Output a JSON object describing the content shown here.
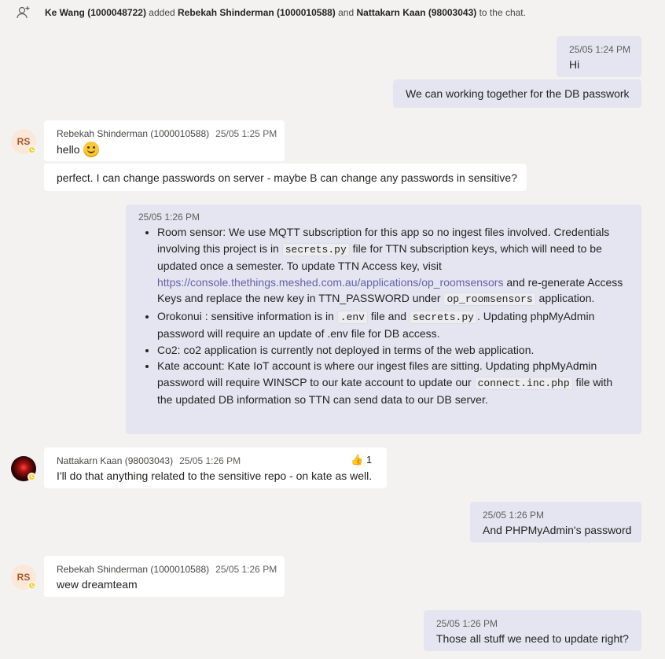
{
  "system_message": {
    "icon": "add-person-icon",
    "actor": "Ke Wang (1000048722)",
    "added_verb": "added",
    "user1": "Rebekah Shinderman (1000010588)",
    "and_word": "and",
    "user2": "Nattakarn Kaan (98003043)",
    "suffix": "to the chat."
  },
  "messages": {
    "m1": {
      "time": "25/05 1:24 PM",
      "text": "Hi"
    },
    "m2": {
      "text": "We can working together for the DB passwork"
    },
    "m3": {
      "initials": "RS",
      "sender": "Rebekah Shinderman (1000010588)",
      "time": "25/05 1:25 PM",
      "text": "hello",
      "emoji": "slightly-smiling-face-emoji"
    },
    "m4": {
      "text": "perfect. I can change passwords on server -  maybe B can change  any  passwords in sensitive?"
    },
    "m5": {
      "time": "25/05 1:26 PM",
      "b1_t1": "Room sensor: We use MQTT subscription for this app so no ingest files involved. Credentials involving this project is in ",
      "b1_code1": "secrets.py",
      "b1_t2": " file for TTN subscription keys, which will need to be updated once a semester. To update TTN Access key, visit ",
      "b1_link": "https://console.thethings.meshed.com.au/applications/op_roomsensors",
      "b1_t3": " and re-generate Access Keys and replace the new key in TTN_PASSWORD under ",
      "b1_code2": "op_roomsensors",
      "b1_t4": " application.",
      "b2_t1": "Orokonui : sensitive information is in ",
      "b2_code1": ".env",
      "b2_t2": " file and ",
      "b2_code2": "secrets.py",
      "b2_t3": ". Updating phpMyAdmin password will require an update of .env file for DB access.",
      "b3": "Co2: co2 application is currently not deployed in terms of the web application.",
      "b4_t1": "Kate account: Kate IoT account is where our ingest files are sitting. Updating phpMyAdmin password will require WINSCP to our kate account to update our ",
      "b4_code1": "connect.inc.php",
      "b4_t2": " file with the updated DB information so TTN can send data to our DB server."
    },
    "m6": {
      "sender": "Nattakarn Kaan (98003043)",
      "time": "25/05 1:26 PM",
      "text": "I'll do that anything related to the sensitive repo - on kate as well.",
      "reaction_icon": "thumbs-up-icon",
      "reaction_count": "1"
    },
    "m7": {
      "time": "25/05 1:26 PM",
      "text": "And PHPMyAdmin's password"
    },
    "m8": {
      "initials": "RS",
      "sender": "Rebekah Shinderman (1000010588)",
      "time": "25/05 1:26 PM",
      "text": "wew dreamteam"
    },
    "m9": {
      "time": "25/05 1:26 PM",
      "text": "Those all stuff we need to update right?"
    }
  },
  "colors": {
    "background": "#f3f2f1",
    "my_bubble": "#e5e5f1",
    "other_bubble": "#ffffff",
    "link": "#6264a7",
    "presence_away": "#f8d22a"
  }
}
